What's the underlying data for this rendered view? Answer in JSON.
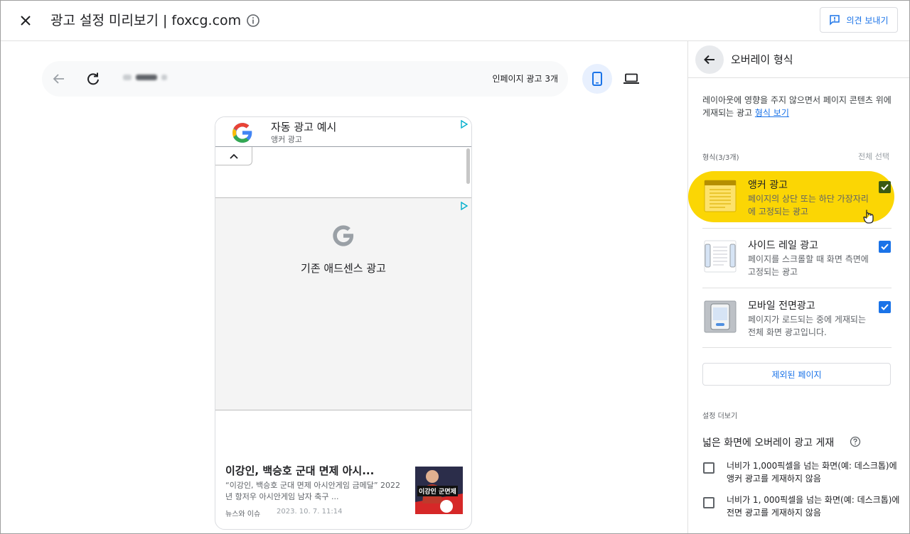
{
  "header": {
    "title": "광고 설정 미리보기 | foxcg.com",
    "feedback_label": "의견 보내기"
  },
  "preview": {
    "inpage_ads": "인페이지 광고 3개",
    "anchor_ad": {
      "title": "자동 광고 예시",
      "subtitle": "앵커 광고"
    },
    "adsense_label": "기존 애드센스 광고",
    "article": {
      "title": "이강인, 백승호 군대 면제 아시...",
      "description": "“이강인, 백승호 군대 면제 아시안게임 금메달” 2022년 항저우 아시안게임 남자 축구 ...",
      "source": "뉴스와 이슈",
      "date": "2023. 10. 7. 11:14",
      "thumb_caption": "이강인 군면제"
    }
  },
  "panel": {
    "title": "오버레이 형식",
    "description": "레이아웃에 영향을 주지 않으면서 페이지 콘텐츠 위에 게재되는 광고",
    "description_link": "형식 보기",
    "format_label": "형식(3/3개)",
    "select_all": "전체 선택",
    "formats": [
      {
        "title": "앵커 광고",
        "desc": "페이지의 상단 또는 하단 가장자리에 고정되는 광고",
        "checked": true
      },
      {
        "title": "사이드 레일 광고",
        "desc": "페이지를 스크롤할 때 화면 측면에 고정되는 광고",
        "checked": true
      },
      {
        "title": "모바일 전면광고",
        "desc": "페이지가 로드되는 중에 게재되는 전체 화면 광고입니다.",
        "checked": true
      }
    ],
    "excluded_pages": "제외된 페이지",
    "more_settings": "설정 더보기",
    "wide_screen_title": "넓은 화면에 오버레이 광고 게재",
    "options": [
      {
        "text": "너비가 1,000픽셀을 넘는 화면(예: 데스크톱)에 앵커 광고를 게재하지 않음",
        "checked": false
      },
      {
        "text": "너비가 1, 000픽셀을 넘는 화면(예: 데스크톱)에 전면 광고를 게재하지 않음",
        "checked": false
      }
    ]
  },
  "colors": {
    "accent": "#1a73e8",
    "highlight": "#fbd604"
  }
}
